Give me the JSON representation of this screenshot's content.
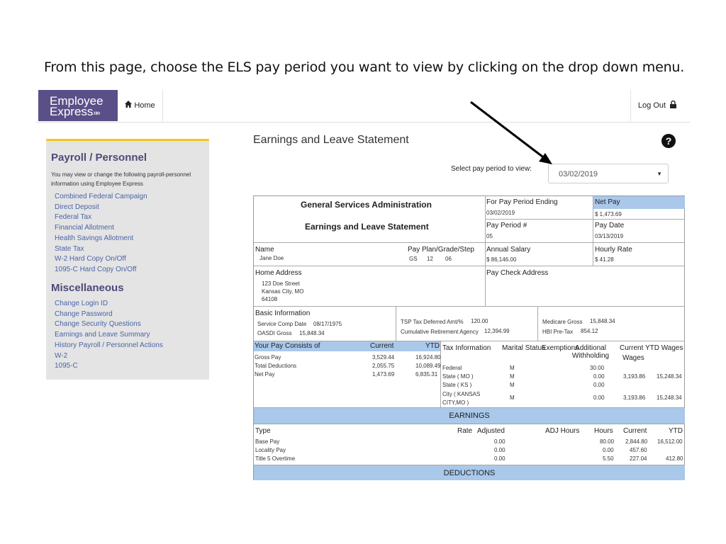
{
  "caption": "From this page, choose the ELS pay period you want to view by clicking on the drop down menu.",
  "header": {
    "logo_line1": "Employee",
    "logo_line2": "Express",
    "logo_chevrons": "»»",
    "home_label": "Home",
    "logout_label": "Log Out"
  },
  "sidebar": {
    "section1_title": "Payroll / Personnel",
    "section1_desc": "You may view or change the following payroll-personnel information using Employee Express",
    "section1_links": [
      "Combined Federal Campaign",
      "Direct Deposit",
      "Federal Tax",
      "Financial Allotment",
      "Health Savings Allotment",
      "State Tax",
      "W-2 Hard Copy On/Off",
      "1095-C Hard Copy On/Off"
    ],
    "section2_title": "Miscellaneous",
    "section2_links": [
      "Change Login ID",
      "Change Password",
      "Change Security Questions",
      "Earnings and Leave Summary",
      "History Payroll / Personnel Actions",
      "W-2",
      "1095-C"
    ]
  },
  "main": {
    "title": "Earnings and Leave Statement",
    "help": "?",
    "period_label": "Select pay period to view:",
    "period_value": "03/02/2019"
  },
  "statement": {
    "agency": "General Services Administration",
    "doc_title": "Earnings and Leave Statement",
    "period_ending_label": "For Pay Period Ending",
    "period_ending": "03/02/2019",
    "net_pay_label": "Net Pay",
    "net_pay": "$ 1,473.69",
    "pay_period_label": "Pay Period #",
    "pay_period": "05",
    "pay_date_label": "Pay Date",
    "pay_date": "03/13/2019",
    "name_label": "Name",
    "name": "Jane Doe",
    "ppgs_label": "Pay Plan/Grade/Step",
    "ppgs_plan": "GS",
    "ppgs_grade": "12",
    "ppgs_step": "06",
    "annual_salary_label": "Annual Salary",
    "annual_salary": "$ 86,146.00",
    "hourly_rate_label": "Hourly Rate",
    "hourly_rate": "$ 41.28",
    "home_address_label": "Home Address",
    "address_1": "123 Doe Street",
    "address_2": "Kansas City, MO",
    "address_3": "64108",
    "paycheck_address_label": "Pay Check Address",
    "basic_info_label": "Basic Information",
    "scd_label": "Service Comp Date",
    "scd": "08/17/1975",
    "oasdi_label": "OASDI Gross",
    "oasdi": "15,848.34",
    "tsp_label": "TSP Tax Deferred Amt/%",
    "tsp": "120.00",
    "cra_label": "Cumulative Retirement Agency",
    "cra": "12,394.99",
    "medicare_label": "Medicare Gross",
    "medicare": "15,848.34",
    "hbi_label": "HBI Pre-Tax",
    "hbi": "854.12",
    "pay_consists_label": "Your Pay Consists of",
    "current_label": "Current",
    "ytd_label": "YTD",
    "pay_rows": [
      {
        "name": "Gross Pay",
        "current": "3,529.44",
        "ytd": "16,924.80"
      },
      {
        "name": "Total Deductions",
        "current": "2,055.75",
        "ytd": "10,089.49"
      },
      {
        "name": "Net Pay",
        "current": "1,473.69",
        "ytd": "6,835.31"
      }
    ],
    "tax_info_label": "Tax Information",
    "marital_label": "Marital Status",
    "exemptions_label": "Exemptions",
    "addl_withholding_label": "Additional Withholding",
    "current_ytd_wages_label": "Current YTD Wages",
    "wages_label": "Wages",
    "tax_rows": [
      {
        "name": "Federal",
        "marital": "M",
        "exemptions": "",
        "addl": "30.00",
        "current": "",
        "ytd": ""
      },
      {
        "name": "State ( MO )",
        "marital": "M",
        "exemptions": "",
        "addl": "0.00",
        "current": "3,193.86",
        "ytd": "15,248.34"
      },
      {
        "name": "State ( KS )",
        "marital": "M",
        "exemptions": "",
        "addl": "0.00",
        "current": "",
        "ytd": ""
      },
      {
        "name": "City ( KANSAS CITY,MO )",
        "marital": "M",
        "exemptions": "",
        "addl": "0.00",
        "current": "3,193.86",
        "ytd": "15,248.34"
      }
    ],
    "earnings_banner": "EARNINGS",
    "earn_type_label": "Type",
    "earn_rate_label": "Rate",
    "earn_adjusted_label": "Adjusted",
    "earn_adj_hours_label": "ADJ Hours",
    "earn_hours_label": "Hours",
    "earn_current_label": "Current",
    "earn_ytd_label": "YTD",
    "earn_rows": [
      {
        "type": "Base Pay",
        "adjusted": "0.00",
        "hours": "80.00",
        "current": "2,844.80",
        "ytd": "16,512.00"
      },
      {
        "type": "Locality Pay",
        "adjusted": "0.00",
        "hours": "0.00",
        "current": "457.60",
        "ytd": ""
      },
      {
        "type": "Title 5 Overtime",
        "adjusted": "0.00",
        "hours": "5.50",
        "current": "227.04",
        "ytd": "412.80"
      }
    ],
    "deductions_banner": "DEDUCTIONS"
  }
}
